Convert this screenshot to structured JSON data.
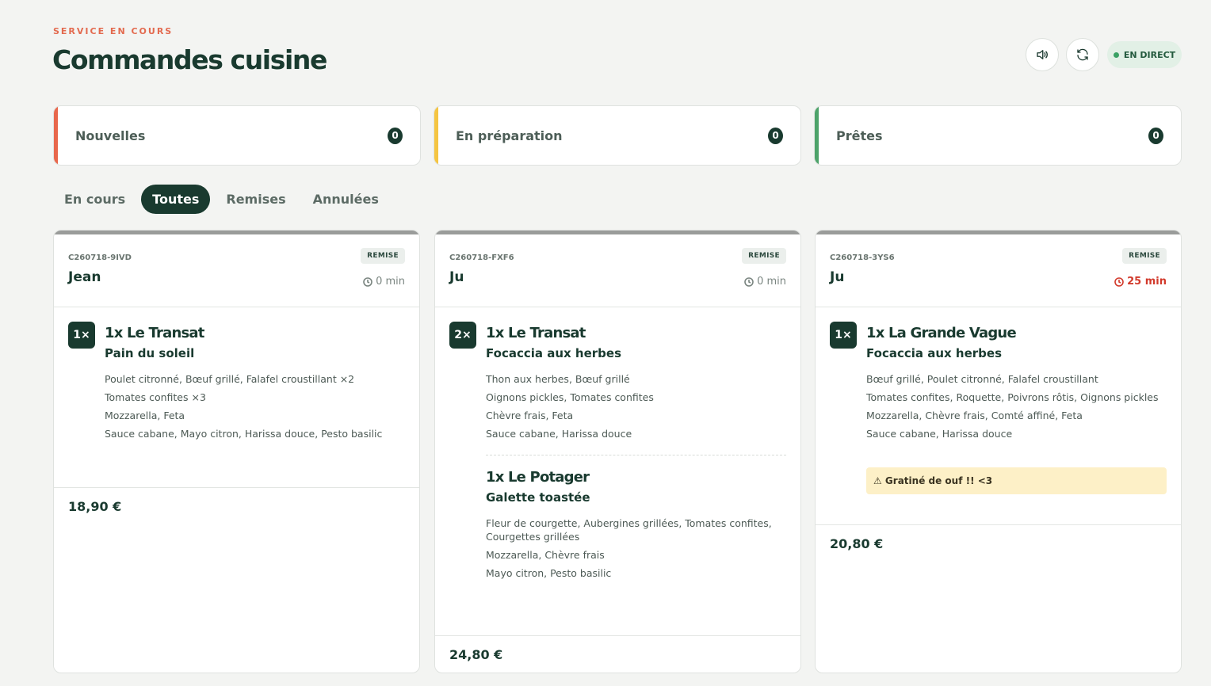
{
  "header": {
    "eyebrow": "SERVICE EN COURS",
    "title": "Commandes cuisine",
    "live_label": "EN DIRECT",
    "sound_icon": "speaker-icon",
    "refresh_icon": "refresh-icon"
  },
  "stats": [
    {
      "label": "Nouvelles",
      "count": "0",
      "color": "#e8674c"
    },
    {
      "label": "En préparation",
      "count": "0",
      "color": "#f5c542"
    },
    {
      "label": "Prêtes",
      "count": "0",
      "color": "#4da36a"
    }
  ],
  "tabs": [
    {
      "label": "En cours",
      "active": false
    },
    {
      "label": "Toutes",
      "active": true
    },
    {
      "label": "Remises",
      "active": false
    },
    {
      "label": "Annulées",
      "active": false
    }
  ],
  "orders": [
    {
      "code": "C260718-9IVD",
      "name": "Jean",
      "status": "REMISE",
      "time": "0 min",
      "qty": "1×",
      "items": [
        {
          "name": "1x Le Transat",
          "base": "Pain du soleil",
          "lines": [
            "Poulet citronné, Bœuf grillé, Falafel croustillant ×2",
            "Tomates confites ×3",
            "Mozzarella, Feta",
            "Sauce cabane, Mayo citron, Harissa douce, Pesto basilic"
          ]
        }
      ],
      "price": "18,90 €"
    },
    {
      "code": "C260718-FXF6",
      "name": "Ju",
      "status": "REMISE",
      "time": "0 min",
      "qty": "2×",
      "items": [
        {
          "name": "1x Le Transat",
          "base": "Focaccia aux herbes",
          "lines": [
            "Thon aux herbes, Bœuf grillé",
            "Oignons pickles, Tomates confites",
            "Chèvre frais, Feta",
            "Sauce cabane, Harissa douce"
          ]
        },
        {
          "name": "1x Le Potager",
          "base": "Galette toastée",
          "lines": [
            "Fleur de courgette, Aubergines grillées, Tomates confites, Courgettes grillées",
            "Mozzarella, Chèvre frais",
            "Mayo citron, Pesto basilic"
          ]
        }
      ],
      "price": "24,80 €"
    },
    {
      "code": "C260718-3YS6",
      "name": "Ju",
      "status": "REMISE",
      "time": "25 min",
      "qty": "1×",
      "items": [
        {
          "name": "1x La Grande Vague",
          "base": "Focaccia aux herbes",
          "lines": [
            "Bœuf grillé, Poulet citronné, Falafel croustillant",
            "Tomates confites, Roquette, Poivrons rôtis, Oignons pickles",
            "Mozzarella, Chèvre frais, Comté affiné, Feta",
            "Sauce cabane, Harissa douce"
          ]
        }
      ],
      "note": "⚠ Gratiné de ouf !! <3",
      "price": "20,80 €"
    }
  ]
}
